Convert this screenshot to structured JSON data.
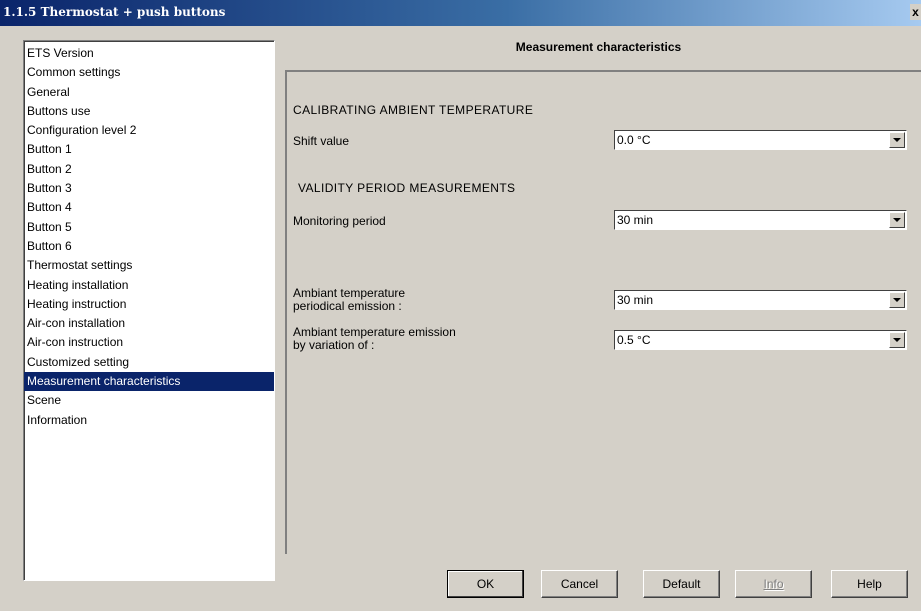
{
  "window": {
    "title": "1.1.5 Thermostat + push buttons",
    "close_label": "x"
  },
  "nav": {
    "items": [
      "ETS Version",
      "Common settings",
      "General",
      "Buttons use",
      "Configuration level 2",
      "Button 1",
      "Button 2",
      "Button 3",
      "Button 4",
      "Button 5",
      "Button 6",
      "Thermostat settings",
      "Heating installation",
      "Heating instruction",
      "Air-con installation",
      "Air-con instruction",
      "Customized setting",
      "Measurement characteristics",
      "Scene",
      "Information"
    ],
    "selected": "Measurement characteristics"
  },
  "section": {
    "title": "Measurement characteristics",
    "calibrating_heading": "CALIBRATING AMBIENT TEMPERATURE",
    "shift_label": "Shift value",
    "shift_value": "0.0 °C",
    "validity_heading": "VALIDITY PERIOD MEASUREMENTS",
    "monitoring_label": "Monitoring period",
    "monitoring_value": "30 min",
    "periodical_label_1": "Ambiant temperature",
    "periodical_label_2": "periodical emission :",
    "periodical_value": "30 min",
    "variation_label_1": "Ambiant temperature emission",
    "variation_label_2": "by variation of :",
    "variation_value": "0.5 °C"
  },
  "buttons": {
    "ok": "OK",
    "cancel": "Cancel",
    "default": "Default",
    "info": "Info",
    "help": "Help"
  }
}
